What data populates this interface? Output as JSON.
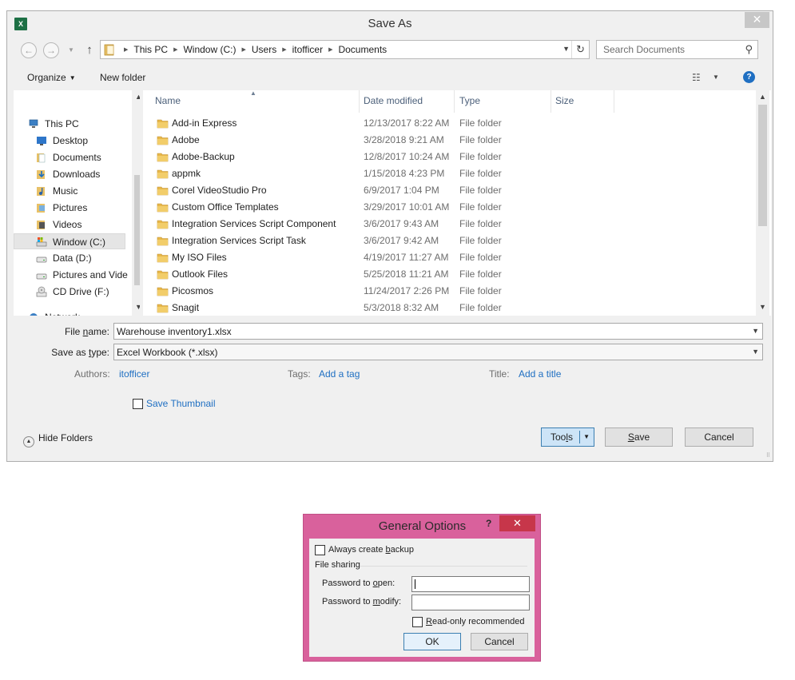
{
  "save_as": {
    "title": "Save As",
    "close_glyph": "✕",
    "nav": {
      "back": "←",
      "forward": "→",
      "up": "↑"
    },
    "breadcrumb": [
      "This PC",
      "Window (C:)",
      "Users",
      "itofficer",
      "Documents"
    ],
    "search_placeholder": "Search Documents",
    "toolbar": {
      "organize": "Organize",
      "new_folder": "New folder"
    },
    "sidebar": [
      {
        "label": "This PC",
        "icon": "computer-icon"
      },
      {
        "label": "Desktop",
        "icon": "desktop-icon"
      },
      {
        "label": "Documents",
        "icon": "documents-icon"
      },
      {
        "label": "Downloads",
        "icon": "downloads-icon"
      },
      {
        "label": "Music",
        "icon": "music-icon"
      },
      {
        "label": "Pictures",
        "icon": "pictures-icon"
      },
      {
        "label": "Videos",
        "icon": "videos-icon"
      },
      {
        "label": "Window (C:)",
        "icon": "drive-c-icon",
        "selected": true
      },
      {
        "label": "Data (D:)",
        "icon": "drive-icon"
      },
      {
        "label": "Pictures and Vide",
        "icon": "drive-icon"
      },
      {
        "label": "CD Drive (F:)",
        "icon": "cd-drive-icon"
      },
      {
        "label": "Network",
        "icon": "network-icon"
      }
    ],
    "columns": {
      "name": "Name",
      "date": "Date modified",
      "type": "Type",
      "size": "Size"
    },
    "files": [
      {
        "name": "Add-in Express",
        "date": "12/13/2017 8:22 AM",
        "type": "File folder"
      },
      {
        "name": "Adobe",
        "date": "3/28/2018 9:21 AM",
        "type": "File folder"
      },
      {
        "name": "Adobe-Backup",
        "date": "12/8/2017 10:24 AM",
        "type": "File folder"
      },
      {
        "name": "appmk",
        "date": "1/15/2018 4:23 PM",
        "type": "File folder"
      },
      {
        "name": "Corel VideoStudio Pro",
        "date": "6/9/2017 1:04 PM",
        "type": "File folder"
      },
      {
        "name": "Custom Office Templates",
        "date": "3/29/2017 10:01 AM",
        "type": "File folder"
      },
      {
        "name": "Integration Services Script Component",
        "date": "3/6/2017 9:43 AM",
        "type": "File folder"
      },
      {
        "name": "Integration Services Script Task",
        "date": "3/6/2017 9:42 AM",
        "type": "File folder"
      },
      {
        "name": "My ISO Files",
        "date": "4/19/2017 11:27 AM",
        "type": "File folder"
      },
      {
        "name": "Outlook Files",
        "date": "5/25/2018 11:21 AM",
        "type": "File folder"
      },
      {
        "name": "Picosmos",
        "date": "11/24/2017 2:26 PM",
        "type": "File folder"
      },
      {
        "name": "Snagit",
        "date": "5/3/2018 8:32 AM",
        "type": "File folder"
      }
    ],
    "file_name_label_pre": "File ",
    "file_name_label_key": "n",
    "file_name_label_post": "ame:",
    "file_name_value": "Warehouse inventory1.xlsx",
    "save_type_label_pre": "Save as ",
    "save_type_label_key": "t",
    "save_type_label_post": "ype:",
    "save_type_value": "Excel Workbook (*.xlsx)",
    "authors_label": "Authors:",
    "authors_value": "itofficer",
    "tags_label": "Tags:",
    "tags_value": "Add a tag",
    "title_label": "Title:",
    "title_value": "Add a title",
    "save_thumbnail": "Save Thumbnail",
    "hide_folders": "Hide Folders",
    "tools_pre": "Too",
    "tools_key": "l",
    "tools_post": "s",
    "save_key": "S",
    "save_post": "ave",
    "cancel": "Cancel"
  },
  "general_options": {
    "title": "General Options",
    "help_glyph": "?",
    "close_glyph": "✕",
    "always_backup_pre": "Always create ",
    "always_backup_key": "b",
    "always_backup_post": "ackup",
    "file_sharing": "File sharing",
    "pw_open_pre": "Password to ",
    "pw_open_key": "o",
    "pw_open_post": "pen:",
    "pw_modify_pre": "Password to ",
    "pw_modify_key": "m",
    "pw_modify_post": "odify:",
    "readonly_key": "R",
    "readonly_post": "ead-only recommended",
    "ok": "OK",
    "cancel": "Cancel"
  },
  "colors": {
    "link": "#1f6fc2",
    "dialog_frame": "#d9619c",
    "close_red": "#c7364a",
    "excel_green": "#1d7045",
    "folder_yellow": "#e8b84a"
  }
}
